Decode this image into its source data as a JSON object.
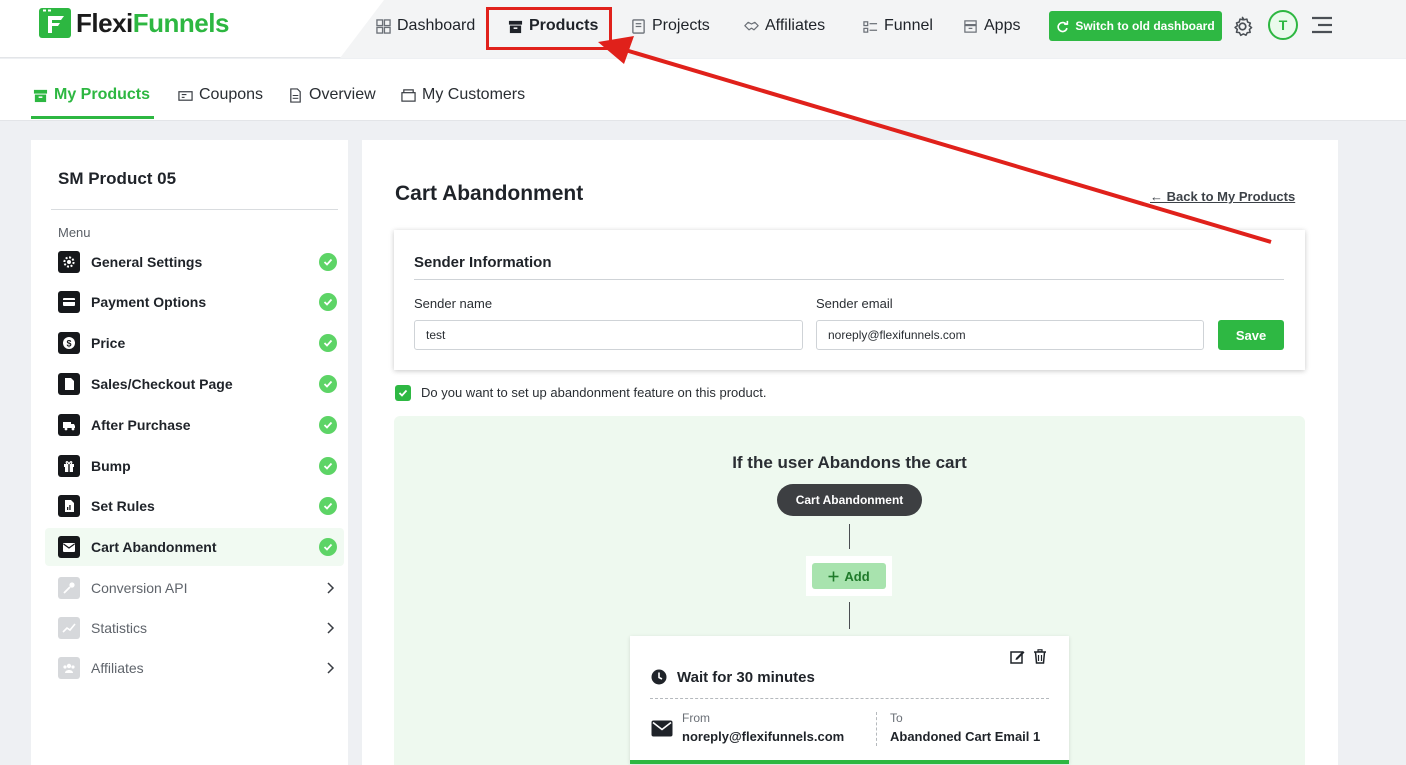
{
  "brand": {
    "name_part1": "Flexi",
    "name_part2": "Funnels"
  },
  "nav": {
    "items": [
      {
        "label": "Dashboard",
        "icon": "grid-icon"
      },
      {
        "label": "Products",
        "icon": "box-icon"
      },
      {
        "label": "Projects",
        "icon": "document-icon"
      },
      {
        "label": "Affiliates",
        "icon": "handshake-icon"
      },
      {
        "label": "Funnel",
        "icon": "funnel-icon"
      },
      {
        "label": "Apps",
        "icon": "apps-icon"
      }
    ],
    "active": "Products",
    "switch_label": "Switch to old dashboard",
    "avatar_initial": "T"
  },
  "subtabs": {
    "items": [
      {
        "label": "My Products",
        "icon": "box-icon"
      },
      {
        "label": "Coupons",
        "icon": "ticket-icon"
      },
      {
        "label": "Overview",
        "icon": "document-icon"
      },
      {
        "label": "My Customers",
        "icon": "folder-icon"
      }
    ],
    "active": "My Products"
  },
  "sidebar": {
    "product_title": "SM Product 05",
    "menu_label": "Menu",
    "items": [
      {
        "label": "General Settings",
        "icon": "gear-icon",
        "state": "complete"
      },
      {
        "label": "Payment Options",
        "icon": "card-icon",
        "state": "complete"
      },
      {
        "label": "Price",
        "icon": "dollar-icon",
        "state": "complete"
      },
      {
        "label": "Sales/Checkout Page",
        "icon": "page-icon",
        "state": "complete"
      },
      {
        "label": "After Purchase",
        "icon": "truck-icon",
        "state": "complete"
      },
      {
        "label": "Bump",
        "icon": "gift-icon",
        "state": "complete"
      },
      {
        "label": "Set Rules",
        "icon": "rules-icon",
        "state": "complete"
      },
      {
        "label": "Cart Abandonment",
        "icon": "envelope-icon",
        "state": "complete",
        "selected": true
      },
      {
        "label": "Conversion API",
        "icon": "key-icon",
        "state": "locked"
      },
      {
        "label": "Statistics",
        "icon": "trend-icon",
        "state": "locked"
      },
      {
        "label": "Affiliates",
        "icon": "people-icon",
        "state": "locked"
      }
    ]
  },
  "main": {
    "title": "Cart Abandonment",
    "back_link": "← Back to My Products",
    "sender": {
      "title": "Sender Information",
      "name_label": "Sender name",
      "name_value": "test",
      "email_label": "Sender email",
      "email_value": "noreply@flexifunnels.com",
      "save_label": "Save"
    },
    "abandon_checkbox": {
      "checked": true,
      "label": "Do you want to set up abandonment feature on this product."
    },
    "flow": {
      "title": "If the user Abandons the cart",
      "trigger_label": "Cart Abandonment",
      "add_label": "Add",
      "step": {
        "title": "Wait for 30 minutes",
        "from_label": "From",
        "from_value": "noreply@flexifunnels.com",
        "to_label": "To",
        "to_value": "Abandoned Cart Email 1"
      }
    }
  },
  "colors": {
    "accent": "#2db741",
    "annotation": "#e0211b",
    "dark": "#16181b"
  }
}
